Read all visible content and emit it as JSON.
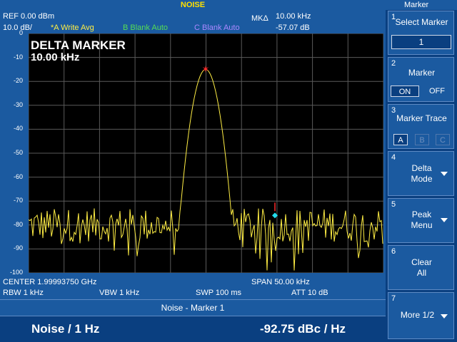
{
  "title": "NOISE",
  "header": {
    "ref": "REF  0.00 dBm",
    "scale": "10.0 dB/",
    "trace_a": "*A Write Avg",
    "trace_b": "B Blank Auto",
    "trace_c": "C Blank Auto",
    "mkd_label": "MKΔ",
    "mkd_freq": "10.00 kHz",
    "mkd_level": "-57.07 dB"
  },
  "plot": {
    "overlay_line1": "DELTA MARKER",
    "overlay_line2": "10.00 kHz",
    "y_ticks": [
      "0",
      "-10",
      "-20",
      "-30",
      "-40",
      "-50",
      "-60",
      "-70",
      "-80",
      "-90",
      "-100"
    ],
    "colors": {
      "trace": "#ffee44",
      "grid": "#5a5a5a",
      "marker_main": "#ff2a2a",
      "marker_delta": "#22ddee"
    }
  },
  "chart_data": {
    "type": "line",
    "ylim": [
      -100,
      0
    ],
    "peak_level_dB": -15,
    "noise_floor_dB": -80,
    "ylabel": "",
    "xlabel": ""
  },
  "footer": {
    "center": "CENTER 1.99993750 GHz",
    "span": "SPAN 50.00 kHz",
    "rbw": "RBW  1 kHz",
    "vbw": "VBW  1 kHz",
    "swp": "SWP  100 ms",
    "att": "ATT  10 dB"
  },
  "status": "Noise - Marker 1",
  "result": {
    "left": "Noise / 1 Hz",
    "right": "-92.75 dBc / Hz"
  },
  "panel": {
    "title": "Marker",
    "btn1": {
      "num": "1",
      "label": "Select Marker",
      "value": "1"
    },
    "btn2": {
      "num": "2",
      "label": "Marker",
      "on": "ON",
      "off": "OFF"
    },
    "btn3": {
      "num": "3",
      "label": "Marker Trace",
      "a": "A",
      "b": "B",
      "c": "C"
    },
    "btn4": {
      "num": "4",
      "line1": "Delta",
      "line2": "Mode"
    },
    "btn5": {
      "num": "5",
      "line1": "Peak",
      "line2": "Menu"
    },
    "btn6": {
      "num": "6",
      "line1": "Clear",
      "line2": "All"
    },
    "btn7": {
      "num": "7",
      "label": "More 1/2"
    }
  }
}
